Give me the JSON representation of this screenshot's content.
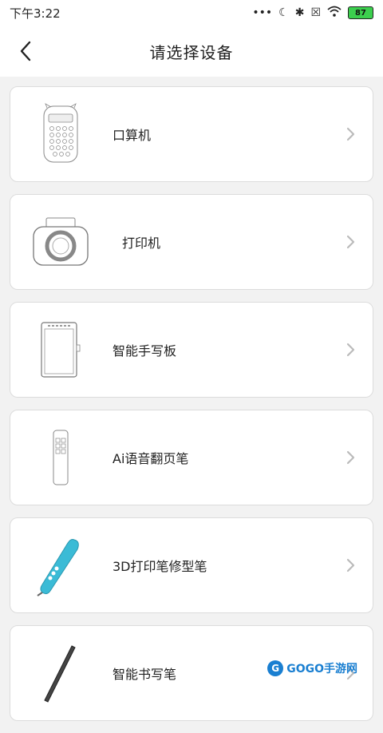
{
  "status": {
    "time": "下午3:22",
    "battery": "87",
    "icons": [
      "more-icon",
      "moon-icon",
      "bluetooth-icon",
      "sim-icon",
      "wifi-icon",
      "battery-icon"
    ]
  },
  "header": {
    "title": "请选择设备",
    "back_icon": "chevron-left-icon"
  },
  "devices": [
    {
      "label": "口算机",
      "icon": "calculator-device-icon"
    },
    {
      "label": "打印机",
      "icon": "printer-device-icon"
    },
    {
      "label": "智能手写板",
      "icon": "tablet-device-icon"
    },
    {
      "label": "Ai语音翻页笔",
      "icon": "presenter-device-icon"
    },
    {
      "label": "3D打印笔修型笔",
      "icon": "3d-pen-device-icon"
    },
    {
      "label": "智能书写笔",
      "icon": "smart-pen-device-icon"
    }
  ],
  "watermark": {
    "text": "GOGO手游网"
  },
  "colors": {
    "background": "#f2f2f2",
    "card_border": "#dcdcdc",
    "chevron": "#bbbbbb",
    "pen_accent": "#3bbbd6",
    "watermark": "#1a7fd1"
  }
}
